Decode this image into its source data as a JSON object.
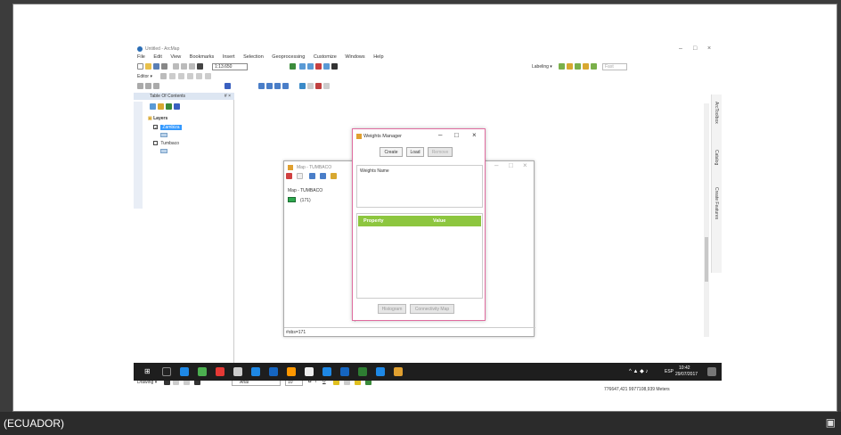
{
  "window": {
    "title": "Untitled - ArcMap",
    "controls": [
      "–",
      "□",
      "×"
    ]
  },
  "menu": [
    "File",
    "Edit",
    "View",
    "Bookmarks",
    "Insert",
    "Selection",
    "Geoprocessing",
    "Customize",
    "Windows",
    "Help"
  ],
  "toolbar": {
    "scale": "1:13.650",
    "editor": "Editor ▾",
    "labeling": "Labeling ▾",
    "fast": "Fast"
  },
  "toc": {
    "title": "Table Of Contents",
    "close": "# ×",
    "layers_label": "Layers",
    "items": [
      "Zambiza",
      "Tumbaco"
    ]
  },
  "right_dock": [
    "ArcToolbox",
    "Catalog",
    "Create Features"
  ],
  "map_window": {
    "title": "Map - TUMBACO",
    "list_title": "Map - TUMBACO",
    "count": "(171)",
    "status": "#obs=171",
    "controls": [
      "–",
      "□",
      "×"
    ]
  },
  "weights_manager": {
    "title": "Weights Manager",
    "controls": [
      "–",
      "□",
      "×"
    ],
    "buttons": {
      "create": "Create",
      "load": "Load",
      "remove": "Remove"
    },
    "weights_name_label": "Weights Name",
    "property_header": "Property",
    "value_header": "Value",
    "histogram": "Histogram",
    "connectivity_map": "Connectivity Map"
  },
  "drawing": {
    "label": "Drawing ▾",
    "font": "Arial",
    "size": "10"
  },
  "status": {
    "coords": "776647,421  9977108,939 Meters"
  },
  "taskbar": {
    "lang": "ESP",
    "time": "10:42",
    "date": "29/07/2017"
  },
  "footer": {
    "label": "(ECUADOR)"
  }
}
